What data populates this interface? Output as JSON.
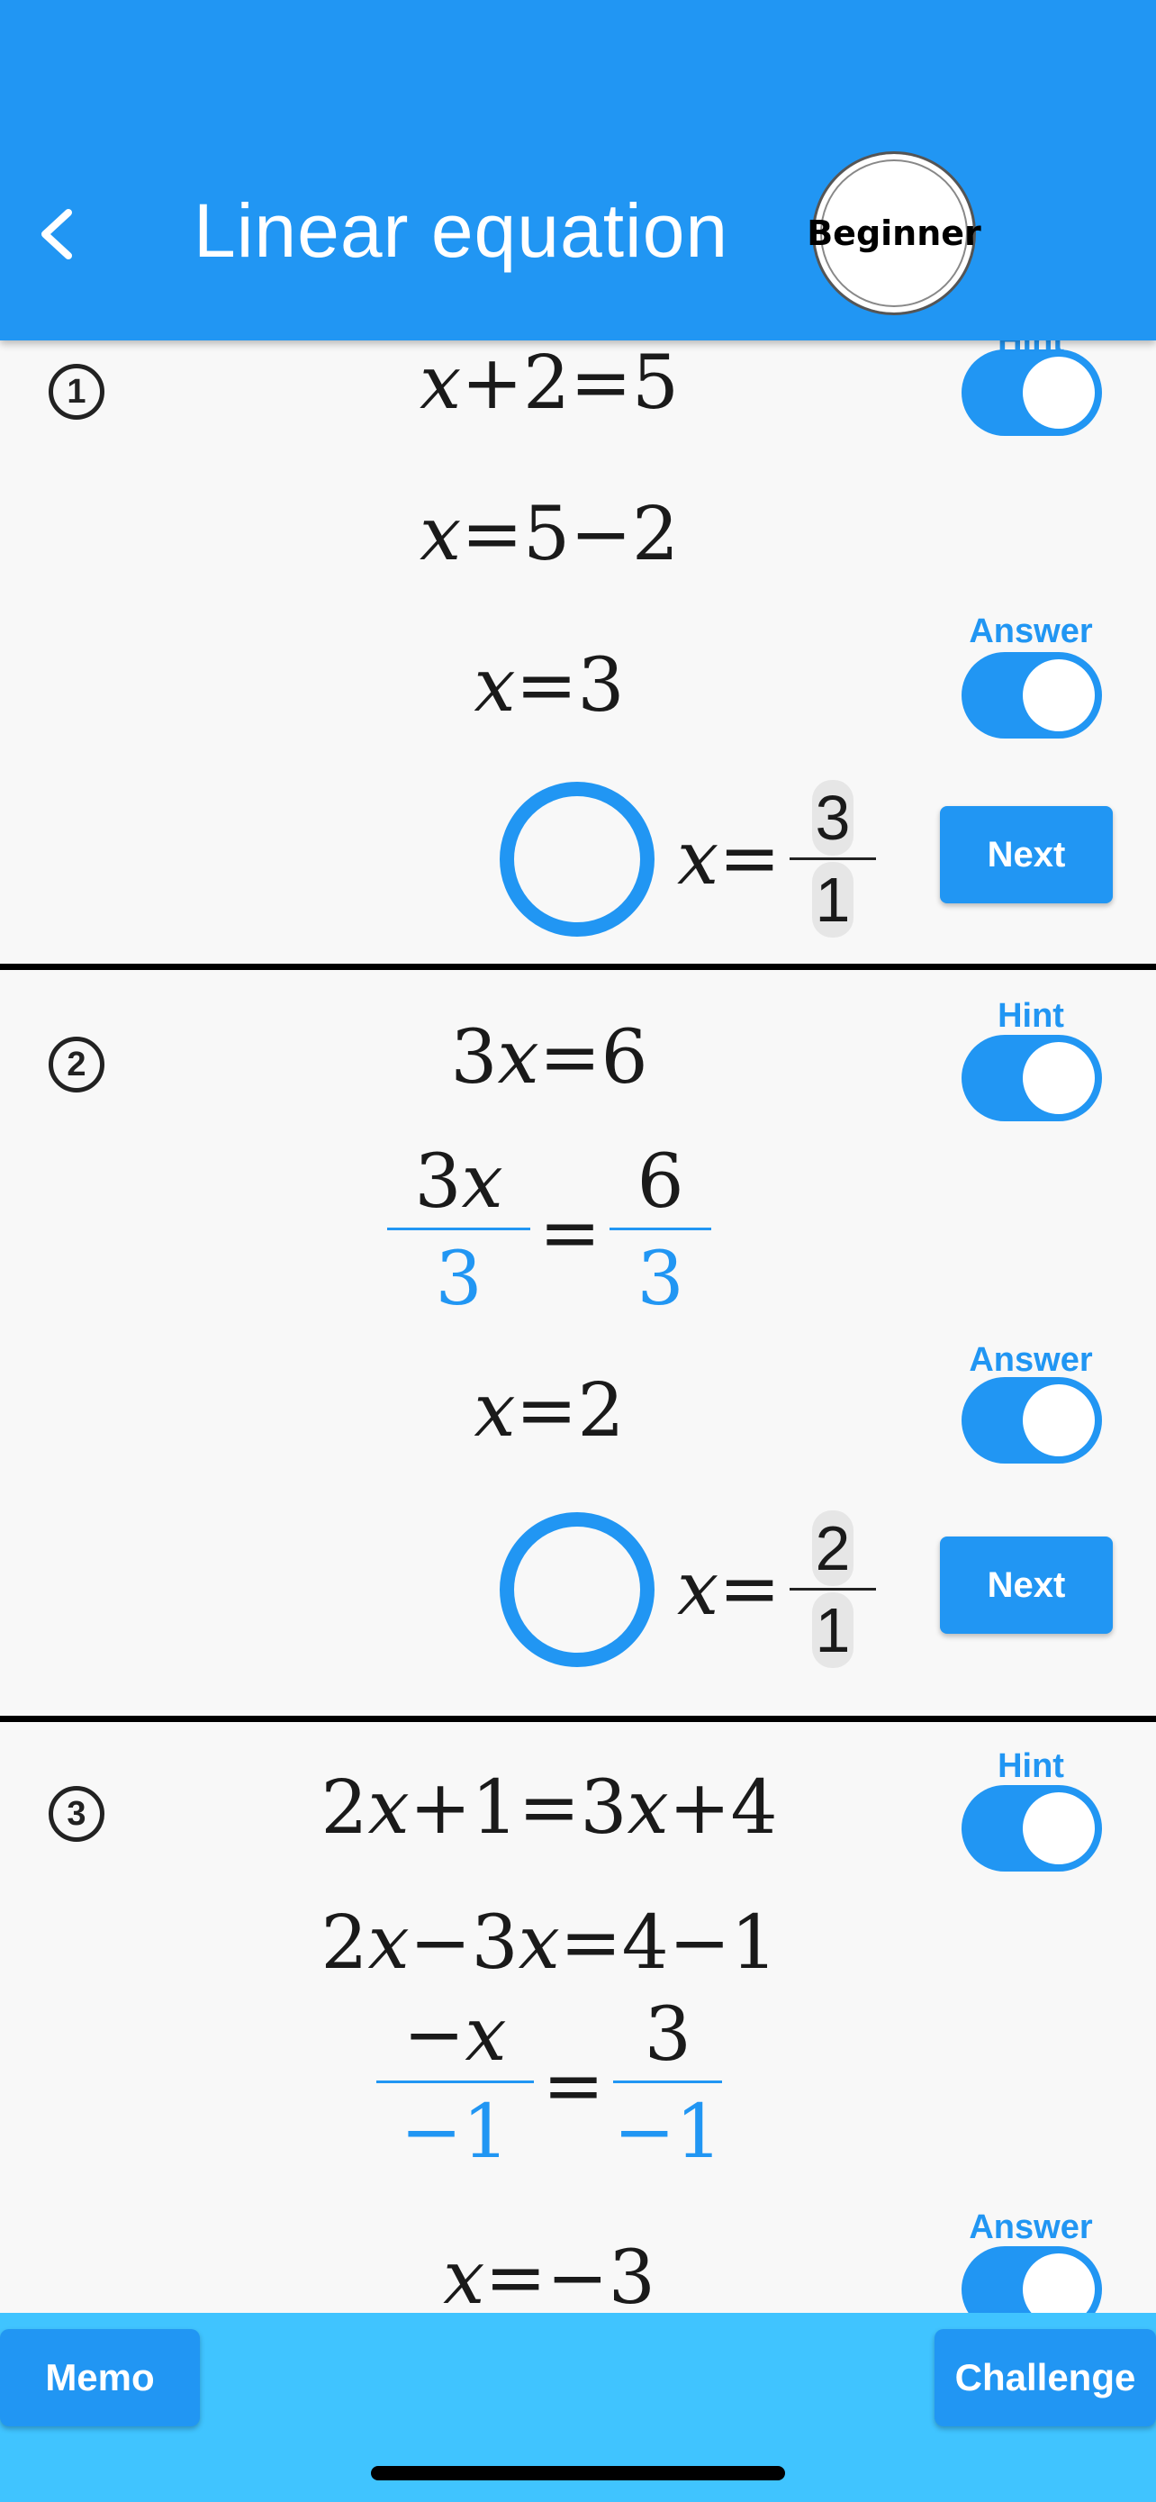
{
  "header": {
    "title": "Linear equation",
    "level": "Beginner"
  },
  "labels": {
    "hint": "Hint",
    "answer": "Answer",
    "next": "Next"
  },
  "problems": [
    {
      "number": "1",
      "lines": [
        "x+2=5",
        "x=5−2",
        "x=3"
      ],
      "answer": {
        "lhs": "x=",
        "numerator": "3",
        "denominator": "1"
      }
    },
    {
      "number": "2",
      "line1": "3x=6",
      "frac": {
        "left_top": "3x",
        "left_bot": "3",
        "right_top": "6",
        "right_bot": "3"
      },
      "line3": "x=2",
      "answer": {
        "lhs": "x=",
        "numerator": "2",
        "denominator": "1"
      }
    },
    {
      "number": "3",
      "line1": "2x+1=3x+4",
      "line2": "2x−3x=4−1",
      "frac": {
        "left_top": "−x",
        "left_bot": "−1",
        "right_top": "3",
        "right_bot": "−1"
      },
      "line4": "x=−3"
    }
  ],
  "bottom": {
    "memo": "Memo",
    "challenge": "Challenge"
  },
  "colors": {
    "primary": "#2196f3",
    "bottom_bar": "#40c4ff"
  }
}
